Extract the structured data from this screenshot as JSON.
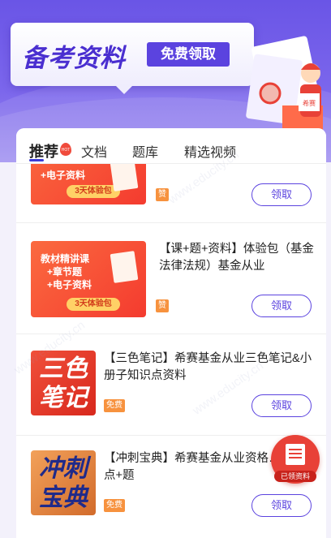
{
  "banner": {
    "title": "备考资料",
    "button_label": "免费领取",
    "mascot_label": "希赛"
  },
  "tabs": [
    {
      "label": "推荐",
      "active": true
    },
    {
      "label": "文档",
      "active": false
    },
    {
      "label": "题库",
      "active": false
    },
    {
      "label": "精选视频",
      "active": false
    }
  ],
  "hot_badge": "HOT",
  "items": [
    {
      "thumb_lines": [
        "+电子资料"
      ],
      "thumb_pill": "3天体验包",
      "badge": "赞",
      "button_label": "领取"
    },
    {
      "thumb_lines": [
        "教材精讲课",
        "+章节题",
        "+电子资料"
      ],
      "thumb_pill": "3天体验包",
      "title": "【课+题+资料】体验包（基金法律法规）基金从业",
      "badge": "赞",
      "button_label": "领取"
    },
    {
      "thumb_text": [
        "三色",
        "笔记"
      ],
      "title": "【三色笔记】希赛基金从业三色笔记&小册子知识点资料",
      "badge": "免费",
      "button_label": "领取"
    },
    {
      "thumb_text": [
        "冲刺",
        "宝典"
      ],
      "title": "【冲刺宝典】希赛基金从业资格…点+题",
      "badge": "免费",
      "button_label": "领取"
    }
  ],
  "fab": {
    "label": "已领资料"
  },
  "watermark": "www.educity.cn",
  "colors": {
    "accent": "#5b43df",
    "banner": "#6a55e6",
    "badge_orange": "#f7923e",
    "red": "#e84137"
  }
}
